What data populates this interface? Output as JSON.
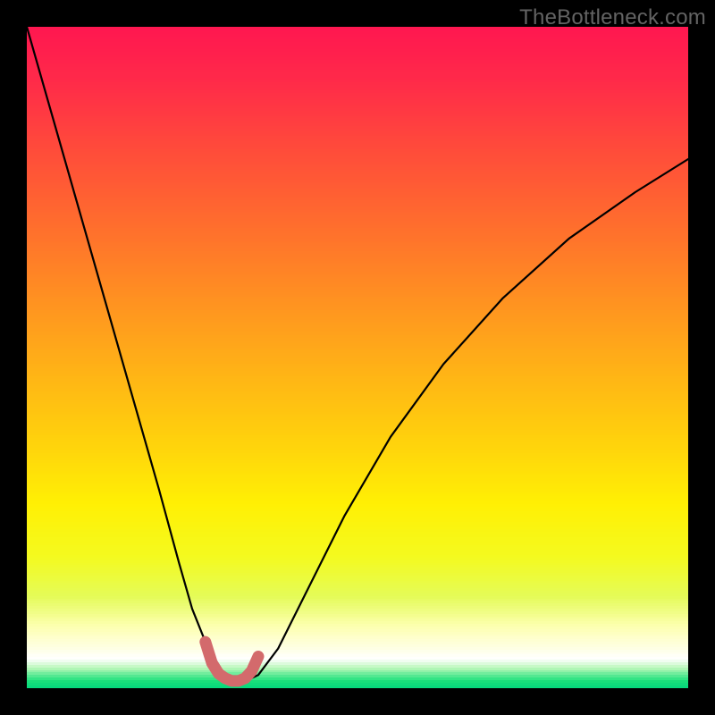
{
  "watermark": {
    "text": "TheBottleneck.com"
  },
  "colors": {
    "frame": "#000000",
    "curve_main": "#000000",
    "curve_accent": "#d36a6c",
    "watermark": "#636363",
    "gradient_stops": [
      {
        "offset": 0.0,
        "color": "#ff1750"
      },
      {
        "offset": 0.08,
        "color": "#ff2a49"
      },
      {
        "offset": 0.18,
        "color": "#ff4a3b"
      },
      {
        "offset": 0.3,
        "color": "#ff6e2d"
      },
      {
        "offset": 0.42,
        "color": "#ff9420"
      },
      {
        "offset": 0.54,
        "color": "#ffb914"
      },
      {
        "offset": 0.64,
        "color": "#ffd60b"
      },
      {
        "offset": 0.72,
        "color": "#fff004"
      },
      {
        "offset": 0.8,
        "color": "#f4fa1f"
      },
      {
        "offset": 0.86,
        "color": "#e4fb58"
      },
      {
        "offset": 0.905,
        "color": "#fdffb0"
      },
      {
        "offset": 0.955,
        "color": "#ffffff"
      },
      {
        "offset": 0.968,
        "color": "#b8f7b8"
      },
      {
        "offset": 0.988,
        "color": "#19e07a"
      },
      {
        "offset": 1.0,
        "color": "#00d57d"
      }
    ]
  },
  "chart_data": {
    "type": "line",
    "title": "",
    "xlabel": "",
    "ylabel": "",
    "xlim": [
      0,
      100
    ],
    "ylim": [
      0,
      100
    ],
    "grid": false,
    "legend": null,
    "series": [
      {
        "name": "main-curve",
        "x": [
          0,
          4,
          8,
          12,
          16,
          20,
          23,
          25,
          27,
          28.5,
          30,
          31,
          32,
          33.5,
          35,
          38,
          42,
          48,
          55,
          63,
          72,
          82,
          92,
          100
        ],
        "y": [
          100,
          86,
          72,
          58,
          44,
          30,
          19,
          12,
          7,
          4,
          2,
          1.3,
          1.1,
          1.3,
          2,
          6,
          14,
          26,
          38,
          49,
          59,
          68,
          75,
          80
        ]
      },
      {
        "name": "accent-segment",
        "x": [
          27,
          28,
          29,
          30,
          31,
          32,
          33,
          34,
          35
        ],
        "y": [
          7,
          3.8,
          2.2,
          1.5,
          1.1,
          1.1,
          1.5,
          2.6,
          4.8
        ]
      }
    ],
    "background_bands": [
      {
        "from_y": 100,
        "to_y": 10,
        "style": "vertical-gradient red→yellow→pale"
      },
      {
        "from_y": 10,
        "to_y": 5,
        "style": "pale / white"
      },
      {
        "from_y": 5,
        "to_y": 0,
        "style": "green"
      }
    ],
    "minimum": {
      "x": 31.5,
      "y": 1.1
    }
  }
}
